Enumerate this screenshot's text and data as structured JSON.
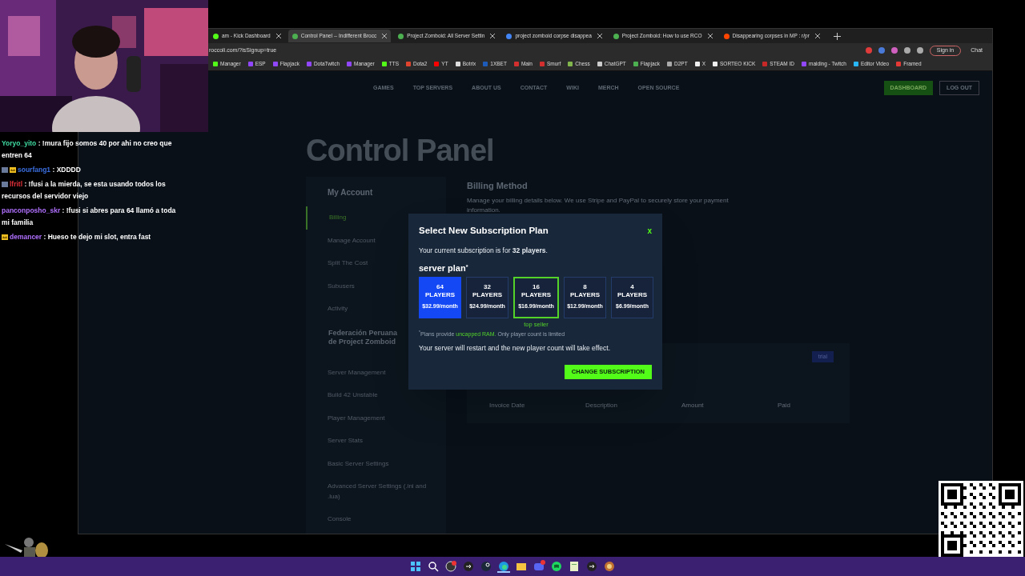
{
  "browser": {
    "tabs": [
      {
        "title": "am - Kick Dashboard",
        "kind": "kick",
        "selected": false
      },
      {
        "title": "Control Panel -- Indifferent Brocc",
        "kind": "site",
        "selected": true
      },
      {
        "title": "Project Zomboid: All Server Settin",
        "kind": "site",
        "selected": false
      },
      {
        "title": "project zomboid corpse disappea",
        "kind": "google",
        "selected": false
      },
      {
        "title": "Project Zomboid: How to use RCO",
        "kind": "site",
        "selected": false
      },
      {
        "title": "Disappearing corpses in MP : r/pr",
        "kind": "reddit",
        "selected": false
      }
    ],
    "address": "roccoli.com/?isSignup=true",
    "sign_in": "Sign in",
    "chat_button": "Chat",
    "bookmarks": [
      {
        "label": "Manager",
        "color": "#53fc18"
      },
      {
        "label": "ESP",
        "color": "#9146ff"
      },
      {
        "label": "Flapjack",
        "color": "#9146ff"
      },
      {
        "label": "DotaTwitch",
        "color": "#9146ff"
      },
      {
        "label": "Manager",
        "color": "#9146ff"
      },
      {
        "label": "TTS",
        "color": "#53fc18"
      },
      {
        "label": "Dota2",
        "color": "#e0442f"
      },
      {
        "label": "YT",
        "color": "#ff0000"
      },
      {
        "label": "Botrix",
        "color": "#dddddd"
      },
      {
        "label": "1XBET",
        "color": "#1e5bb8"
      },
      {
        "label": "Main",
        "color": "#d32f2f"
      },
      {
        "label": "Smurf",
        "color": "#d32f2f"
      },
      {
        "label": "Chess",
        "color": "#81b64c"
      },
      {
        "label": "ChatGPT",
        "color": "#cccccc"
      },
      {
        "label": "Flapjack",
        "color": "#4caf50"
      },
      {
        "label": "D2PT",
        "color": "#aaaaaa"
      },
      {
        "label": "X",
        "color": "#eeeeee"
      },
      {
        "label": "SORTEO KICK",
        "color": "#eeeeee"
      },
      {
        "label": "STEAM ID",
        "color": "#c62828"
      },
      {
        "label": "malding - Twitch",
        "color": "#9146ff"
      },
      {
        "label": "Editor Video",
        "color": "#29b6f6"
      },
      {
        "label": "Framed",
        "color": "#e53935"
      }
    ]
  },
  "site": {
    "nav": [
      "GAMES",
      "TOP SERVERS",
      "ABOUT US",
      "CONTACT",
      "WIKI",
      "MERCH",
      "OPEN SOURCE"
    ],
    "dashboard_button": "DASHBOARD",
    "logout_button": "LOG OUT",
    "heading": "Control Panel",
    "sidebar": {
      "account_title": "My Account",
      "items": [
        {
          "label": "Billing",
          "selected": true
        },
        {
          "label": "Manage Account",
          "selected": false
        },
        {
          "label": "Split The Cost",
          "selected": false
        },
        {
          "label": "Subusers",
          "selected": false
        },
        {
          "label": "Activity",
          "selected": false
        }
      ],
      "server_title": "Federación Peruana de Project Zomboid",
      "server_items": [
        "Server Management",
        "Build 42 Unstable",
        "Player Management",
        "Server Stats",
        "Basic Server Settings",
        "Advanced Server Settings (.ini and .lua)",
        "Console"
      ]
    },
    "billing_title": "Billing Method",
    "billing_text": "Manage your billing details below. We use Stripe and PayPal to securely store your payment information.",
    "badge": "trial",
    "table_columns": [
      "Invoice Date",
      "Description",
      "Amount",
      "Paid"
    ]
  },
  "modal": {
    "title": "Select New Subscription Plan",
    "close": "x",
    "current": "Your current subscription is for **32 players**.",
    "plan_label": "server plan",
    "plan_mark": "*",
    "plans": [
      {
        "count": "64",
        "unit": "PLAYERS",
        "price": "$32.99/month",
        "selected": true,
        "highlighted": false
      },
      {
        "count": "32",
        "unit": "PLAYERS",
        "price": "$24.99/month",
        "selected": false,
        "highlighted": false
      },
      {
        "count": "16",
        "unit": "PLAYERS",
        "price": "$16.99/month",
        "selected": false,
        "highlighted": true,
        "tag": "top seller"
      },
      {
        "count": "8",
        "unit": "PLAYERS",
        "price": "$12.99/month",
        "selected": false,
        "highlighted": false
      },
      {
        "count": "4",
        "unit": "PLAYERS",
        "price": "$6.99/month",
        "selected": false,
        "highlighted": false
      }
    ],
    "note_mark": "*",
    "note_before": "Plans provide ",
    "note_highlight": "uncapped RAM.",
    "note_after": " Only player count is limited",
    "restart_text": "Your server will restart and the new player count will take effect.",
    "submit": "CHANGE SUBSCRIPTION"
  },
  "chat": [
    {
      "user": "Yoryo_yito",
      "color": "#3fd9a0",
      "text": ": !mura fijo somos 40 por ahi no creo que entren 64"
    },
    {
      "user": "sourfang1",
      "color": "#3b6fe0",
      "badges": [
        {
          "kind": "sub"
        },
        {
          "kind": "crown"
        }
      ],
      "text": ": XDDDD"
    },
    {
      "user": "lfritl",
      "color": "#e0303a",
      "badges": [
        {
          "kind": "sub"
        }
      ],
      "text": ": !fusi a la mierda, se esta usando todos los recursos del servidor viejo"
    },
    {
      "user": "panconposho_skr",
      "color": "#b070ff",
      "text": ": !fusi si abres para 64 llamó a toda mi familia"
    },
    {
      "user": "demancer",
      "color": "#b070ff",
      "badges": [
        {
          "kind": "crown"
        }
      ],
      "text": ": Hueso te dejo mi slot, entra fast"
    }
  ],
  "taskbar": {
    "apps": [
      {
        "kind": "windows"
      },
      {
        "kind": "search"
      },
      {
        "kind": "obs"
      },
      {
        "kind": "arrow"
      },
      {
        "kind": "steam"
      },
      {
        "kind": "edge",
        "selected": true
      },
      {
        "kind": "folder"
      },
      {
        "kind": "discord"
      },
      {
        "kind": "spotify"
      },
      {
        "kind": "notes"
      },
      {
        "kind": "arrow"
      },
      {
        "kind": "game"
      }
    ]
  }
}
